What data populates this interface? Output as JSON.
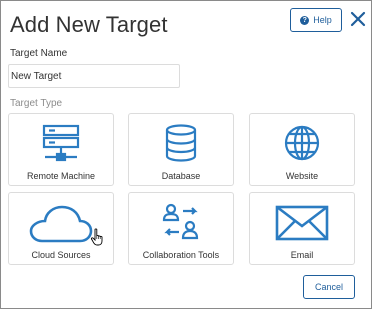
{
  "dialog": {
    "title": "Add New Target",
    "help_label": "Help",
    "cancel_label": "Cancel"
  },
  "target_name": {
    "label": "Target Name",
    "value": "New Target"
  },
  "target_type": {
    "label": "Target Type",
    "options": [
      {
        "label": "Remote Machine",
        "icon": "server-icon"
      },
      {
        "label": "Database",
        "icon": "database-icon"
      },
      {
        "label": "Website",
        "icon": "globe-icon"
      },
      {
        "label": "Cloud Sources",
        "icon": "cloud-icon"
      },
      {
        "label": "Collaboration Tools",
        "icon": "collaboration-icon"
      },
      {
        "label": "Email",
        "icon": "envelope-icon"
      }
    ]
  },
  "colors": {
    "accent": "#1f5e9b",
    "icon_blue": "#2b7cc2",
    "border": "#dcdcdc"
  }
}
